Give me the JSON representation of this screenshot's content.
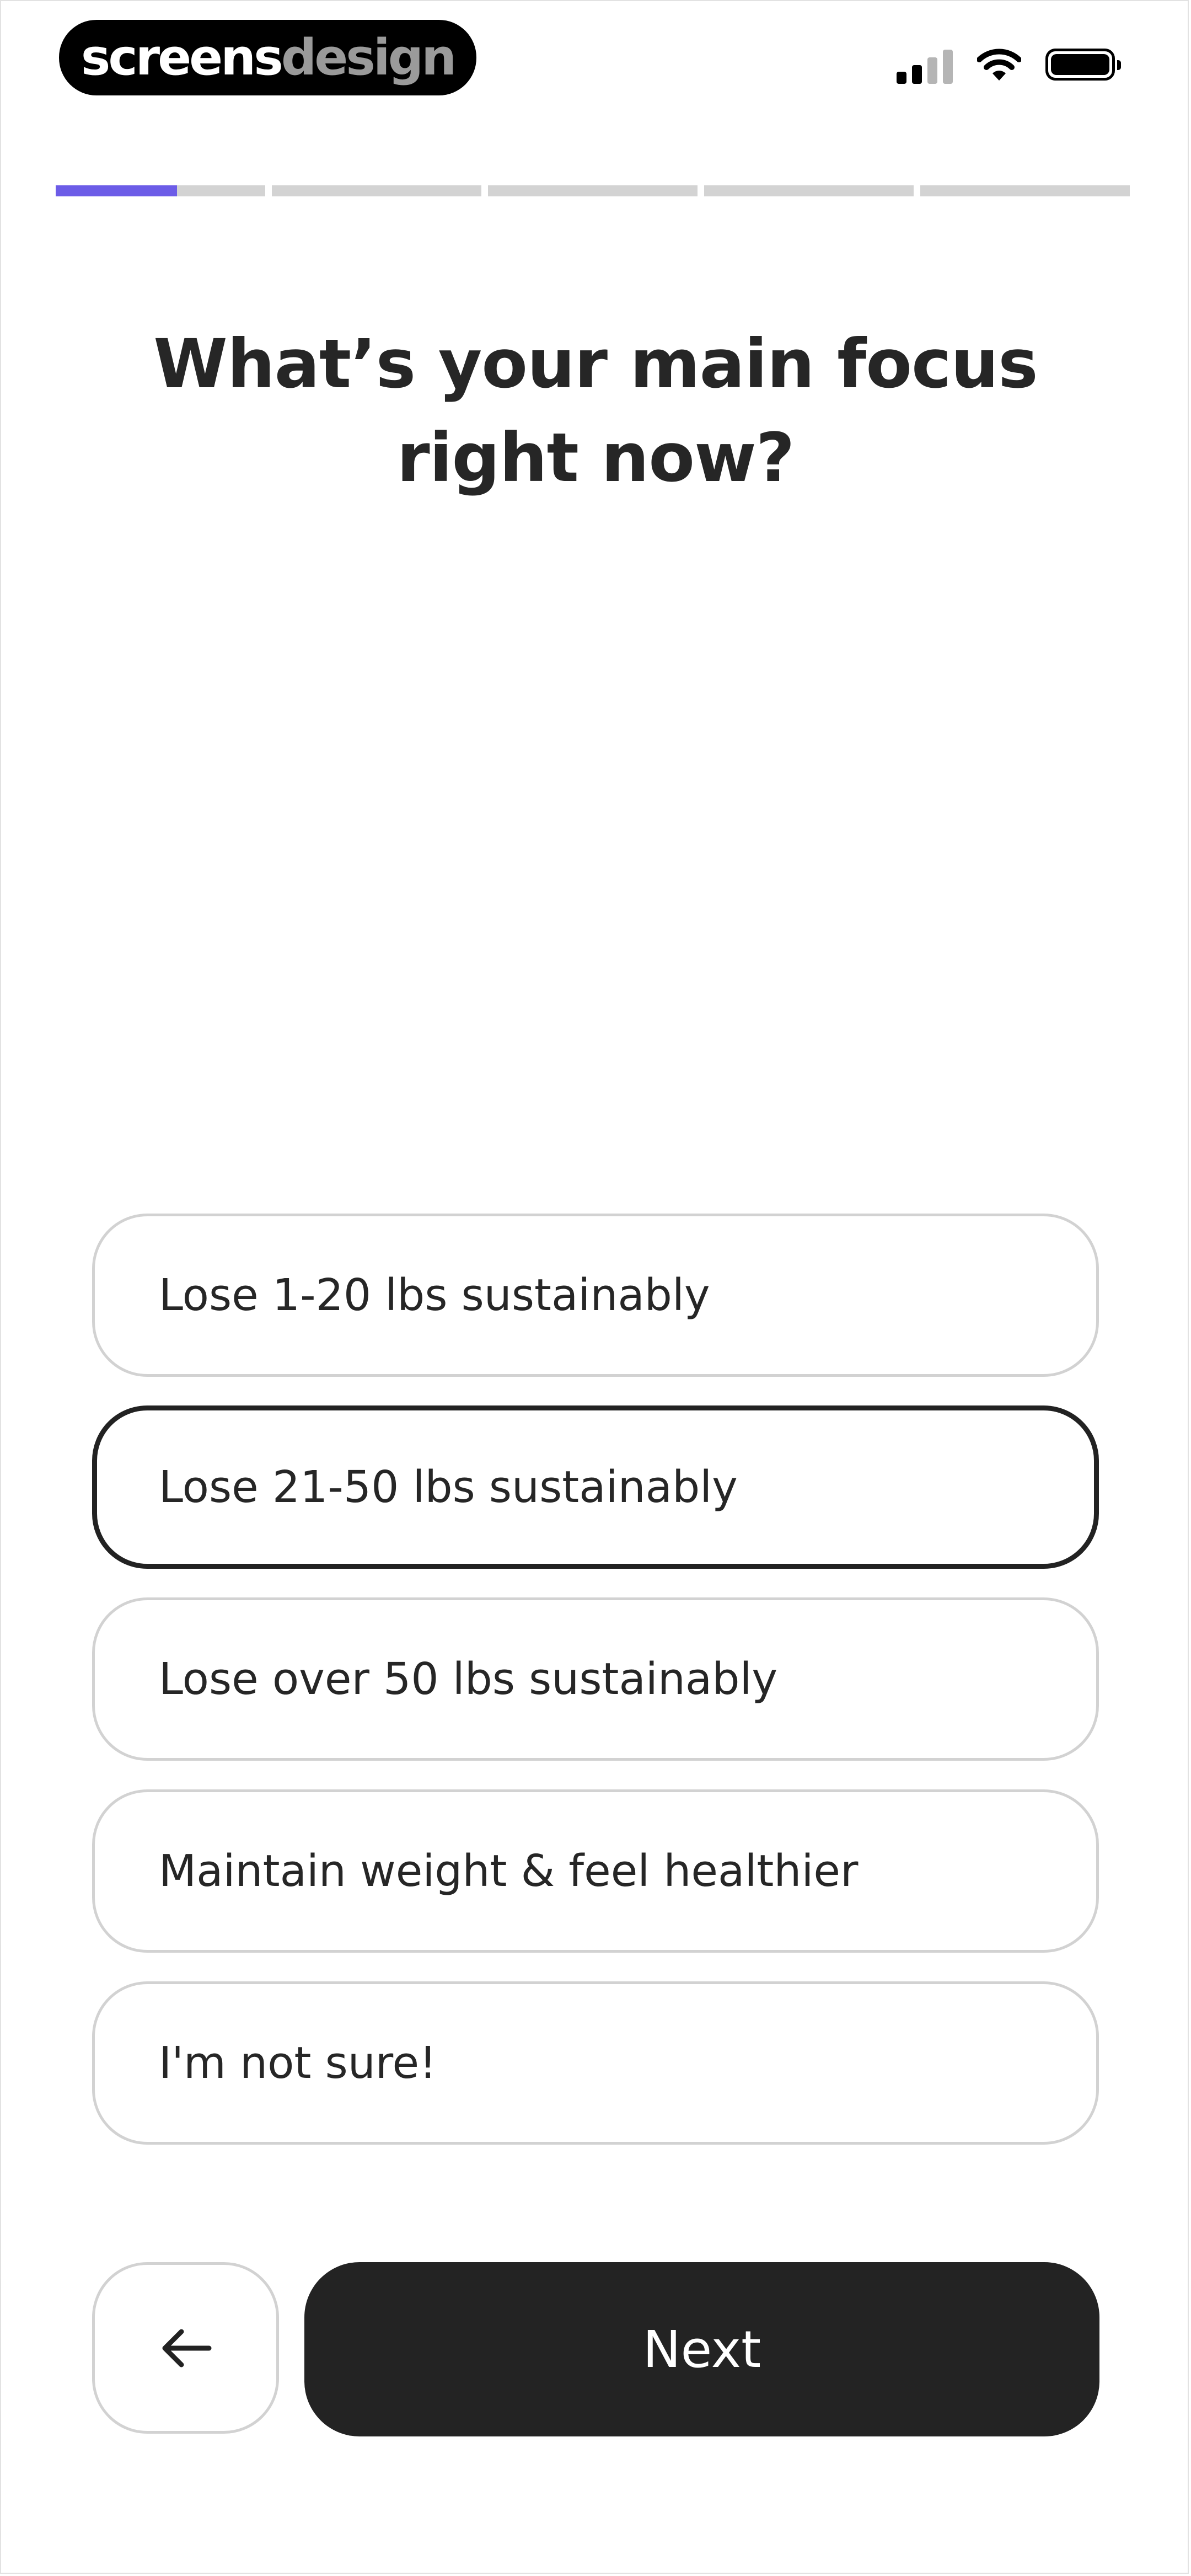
{
  "brand": {
    "part1": "screens",
    "part2": "design"
  },
  "status_bar": {
    "icons": [
      "cellular-signal-icon",
      "wifi-icon",
      "battery-icon"
    ]
  },
  "progress": {
    "current_step": 1,
    "total_steps": 6,
    "step_fill": 0.58,
    "accent": "#6c5ce7"
  },
  "question": {
    "line1": "What’s your main focus",
    "line2": "right now?"
  },
  "options": [
    {
      "label": "Lose 1-20 lbs sustainably",
      "selected": false
    },
    {
      "label": "Lose 21-50 lbs sustainably",
      "selected": true
    },
    {
      "label": "Lose over 50 lbs sustainably",
      "selected": false
    },
    {
      "label": "Maintain weight & feel healthier",
      "selected": false
    },
    {
      "label": "I'm not sure!",
      "selected": false
    }
  ],
  "nav": {
    "back_icon": "arrow-left-icon",
    "next_label": "Next"
  },
  "colors": {
    "primary": "#232323",
    "border": "#d2d2d2",
    "selected_border": "#222222"
  }
}
